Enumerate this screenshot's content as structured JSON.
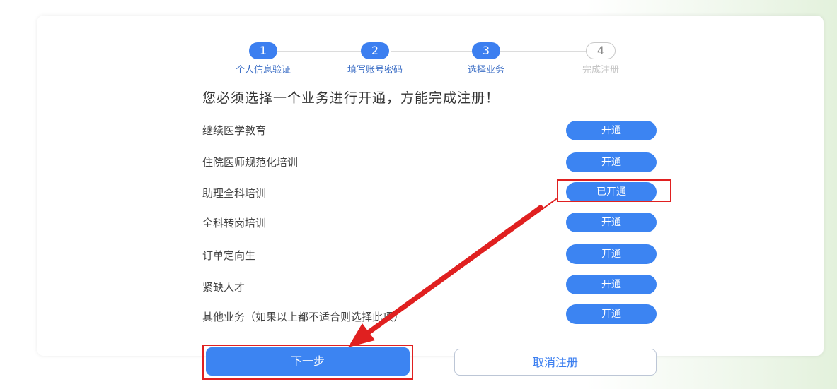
{
  "steps": [
    {
      "number": "1",
      "label": "个人信息验证",
      "state": "done"
    },
    {
      "number": "2",
      "label": "填写账号密码",
      "state": "done"
    },
    {
      "number": "3",
      "label": "选择业务",
      "state": "current"
    },
    {
      "number": "4",
      "label": "完成注册",
      "state": "pending"
    }
  ],
  "headline": "您必须选择一个业务进行开通，方能完成注册！",
  "services": [
    {
      "name": "继续医学教育",
      "button": "开通"
    },
    {
      "name": "住院医师规范化培训",
      "button": "开通"
    },
    {
      "name": "助理全科培训",
      "button": "已开通"
    },
    {
      "name": "全科转岗培训",
      "button": "开通"
    },
    {
      "name": "订单定向生",
      "button": "开通"
    },
    {
      "name": "紧缺人才",
      "button": "开通"
    },
    {
      "name": "其他业务（如果以上都不适合则选择此项）",
      "button": "开通"
    }
  ],
  "actions": {
    "next": "下一步",
    "cancel": "取消注册"
  },
  "colors": {
    "primary": "#3c84f2",
    "annotation_red": "#e02020"
  }
}
